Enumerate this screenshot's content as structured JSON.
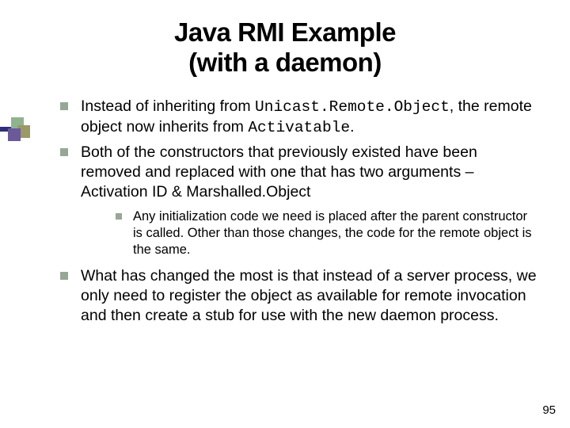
{
  "title_line1": "Java RMI Example",
  "title_line2": "(with a daemon)",
  "bullets": {
    "b1_pre": "Instead of inheriting from ",
    "b1_code1": "Unicast.Remote.Object",
    "b1_mid": ", the remote object now inherits from ",
    "b1_code2": "Activatable",
    "b1_end": ".",
    "b2": "Both of the constructors that previously existed have been removed and replaced with one that has two arguments – Activation ID & Marshalled.Object",
    "b2_sub": "Any initialization code we need is placed after the parent constructor is called.  Other than those changes, the code for the remote object is the same.",
    "b3": "What has changed the most is that instead of a server process, we only need to register the object as available for remote invocation and then create a stub for use with the new daemon process."
  },
  "page_number": "95"
}
